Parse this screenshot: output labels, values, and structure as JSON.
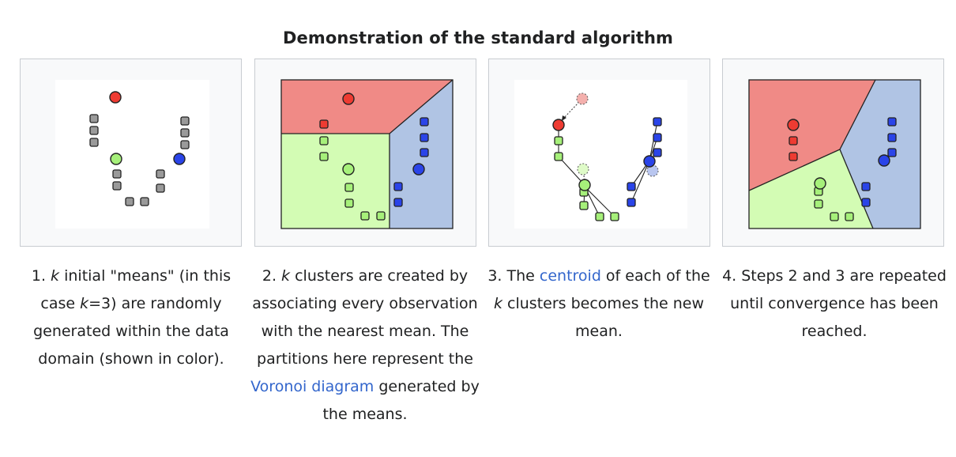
{
  "title": "Demonstration of the standard algorithm",
  "colors": {
    "red": "#ee3b32",
    "green": "#a6f07a",
    "blue": "#2a44e8",
    "gray": "#9a9a9a",
    "region_red": "#f08a86",
    "region_green": "#d3fcb4",
    "region_blue": "#b0c4e4",
    "link": "#3366cc"
  },
  "captions": [
    {
      "num": "1.",
      "k": "k",
      "a": " initial \"means\" (in this case ",
      "k2": "k",
      "b": "=3) are randomly generated within the data domain (shown in color)."
    },
    {
      "num": "2.",
      "k": "k",
      "a": " clusters are created by associating every observation with the nearest mean. The partitions here represent the ",
      "link": "Voronoi diagram",
      "b": " generated by the means."
    },
    {
      "num": "3.",
      "pre": "The ",
      "link": "centroid",
      "a": " of each of the ",
      "k": "k",
      "b": " clusters becomes the new mean."
    },
    {
      "num": "4.",
      "a": "Steps 2 and 3 are repeated until convergence has been reached."
    }
  ]
}
